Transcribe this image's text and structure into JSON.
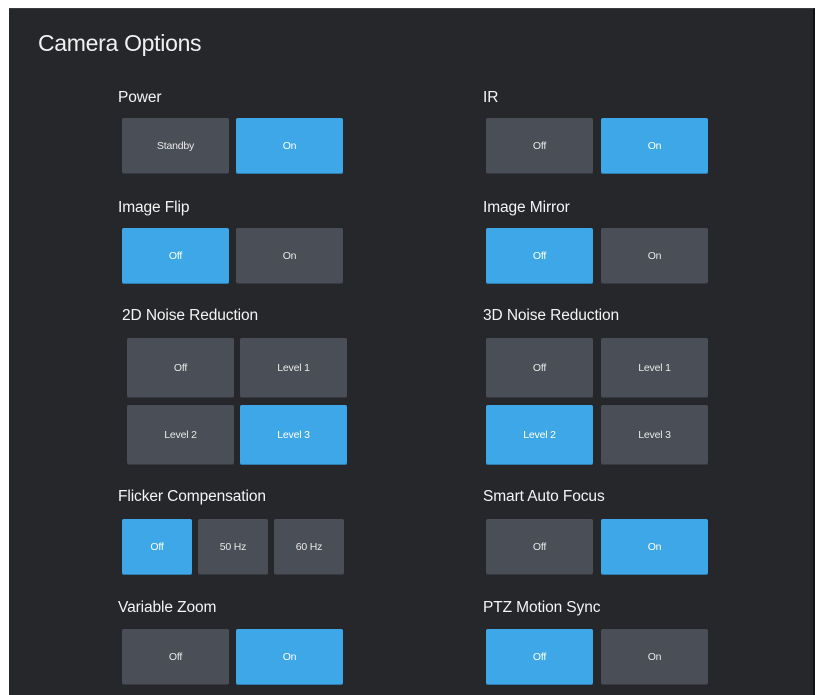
{
  "title": "Camera Options",
  "colors": {
    "panel_bg": "#26272b",
    "button_bg": "#4a4e56",
    "active_bg": "#3ea7e8",
    "text": "#f4f4f4"
  },
  "power": {
    "label": "Power",
    "options": [
      "Standby",
      "On"
    ],
    "selected": "On"
  },
  "ir": {
    "label": "IR",
    "options": [
      "Off",
      "On"
    ],
    "selected": "On"
  },
  "image_flip": {
    "label": "Image Flip",
    "options": [
      "Off",
      "On"
    ],
    "selected": "Off"
  },
  "image_mirror": {
    "label": "Image Mirror",
    "options": [
      "Off",
      "On"
    ],
    "selected": "Off"
  },
  "noise_2d": {
    "label": "2D Noise Reduction",
    "options": [
      "Off",
      "Level 1",
      "Level 2",
      "Level 3"
    ],
    "selected": "Level 3"
  },
  "noise_3d": {
    "label": "3D Noise Reduction",
    "options": [
      "Off",
      "Level 1",
      "Level 2",
      "Level 3"
    ],
    "selected": "Level 2"
  },
  "flicker": {
    "label": "Flicker Compensation",
    "options": [
      "Off",
      "50 Hz",
      "60 Hz"
    ],
    "selected": "Off"
  },
  "smart_af": {
    "label": "Smart Auto Focus",
    "options": [
      "Off",
      "On"
    ],
    "selected": "On"
  },
  "variable_zoom": {
    "label": "Variable Zoom",
    "options": [
      "Off",
      "On"
    ],
    "selected": "On"
  },
  "ptz_sync": {
    "label": "PTZ Motion Sync",
    "options": [
      "Off",
      "On"
    ],
    "selected": "Off"
  }
}
